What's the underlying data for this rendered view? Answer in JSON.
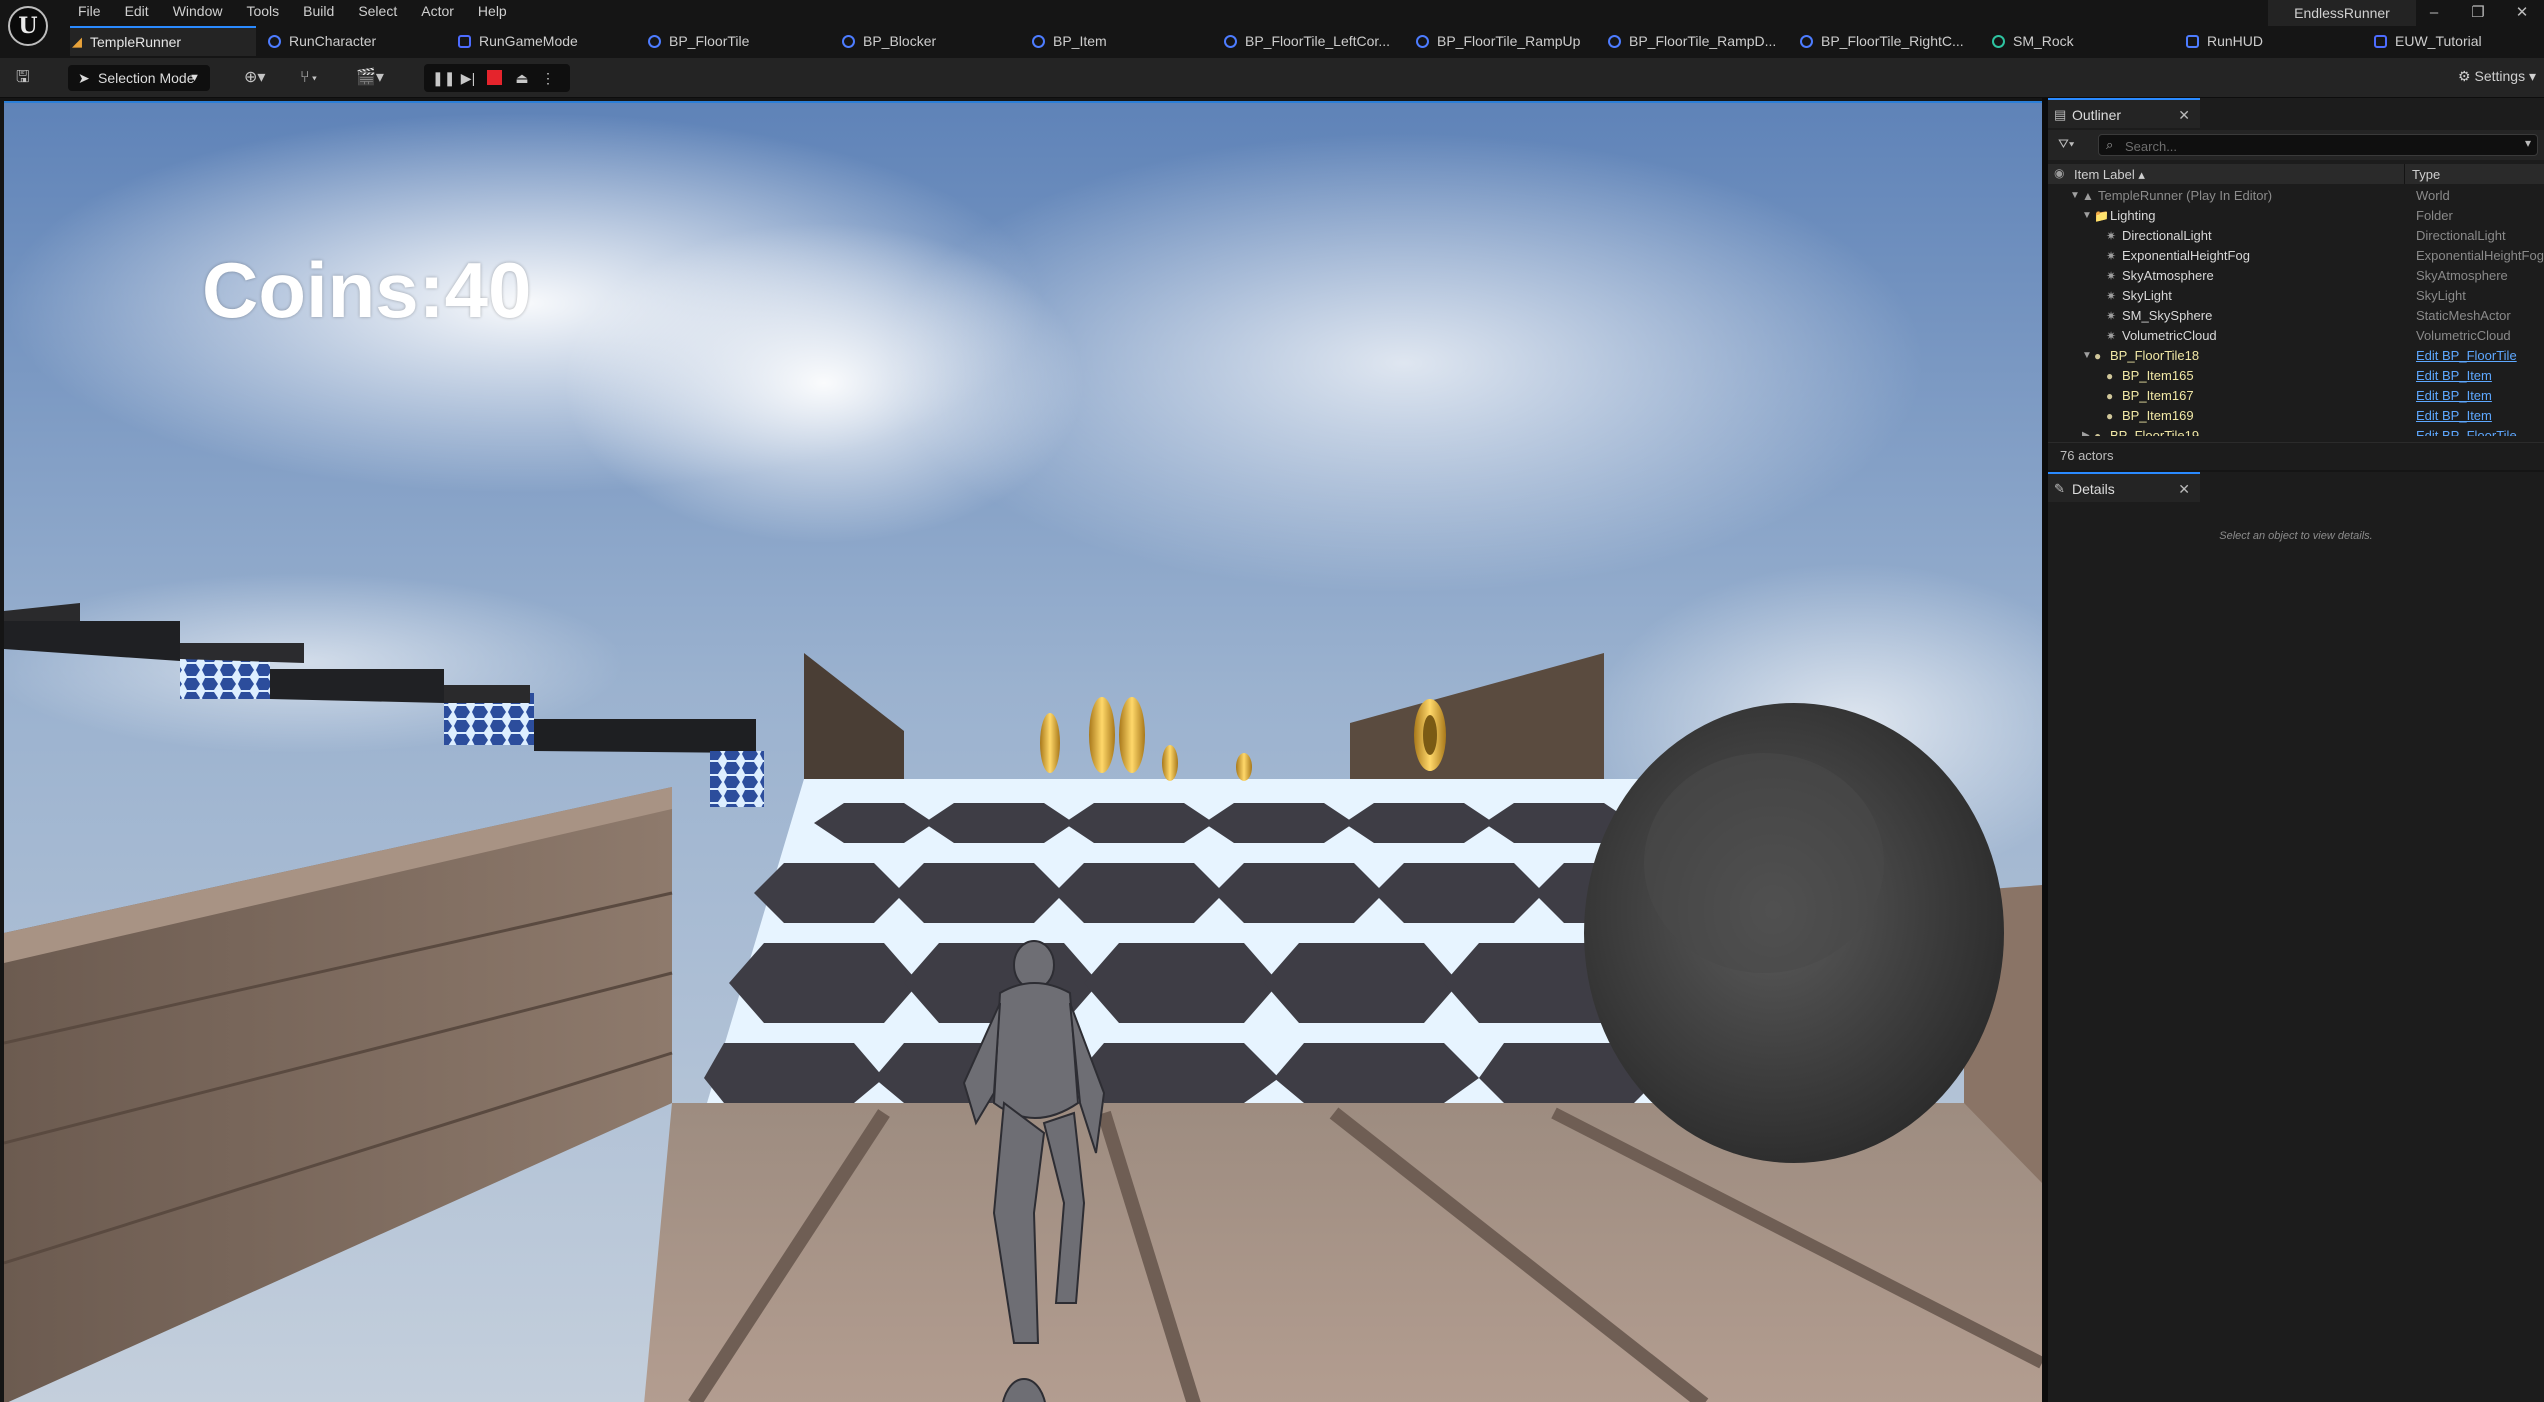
{
  "menu": [
    "File",
    "Edit",
    "Window",
    "Tools",
    "Build",
    "Select",
    "Actor",
    "Help"
  ],
  "project_name": "EndlessRunner",
  "tabs": [
    {
      "label": "TempleRunner",
      "icon": "level-icon",
      "active": true
    },
    {
      "label": "RunCharacter",
      "icon": "blueprint-icon"
    },
    {
      "label": "RunGameMode",
      "icon": "widget-icon"
    },
    {
      "label": "BP_FloorTile",
      "icon": "blueprint-icon"
    },
    {
      "label": "BP_Blocker",
      "icon": "blueprint-icon"
    },
    {
      "label": "BP_Item",
      "icon": "blueprint-icon"
    },
    {
      "label": "BP_FloorTile_LeftCor...",
      "icon": "blueprint-icon"
    },
    {
      "label": "BP_FloorTile_RampUp",
      "icon": "blueprint-icon"
    },
    {
      "label": "BP_FloorTile_RampD...",
      "icon": "blueprint-icon"
    },
    {
      "label": "BP_FloorTile_RightC...",
      "icon": "blueprint-icon"
    },
    {
      "label": "SM_Rock",
      "icon": "static-mesh-icon"
    },
    {
      "label": "RunHUD",
      "icon": "hud-icon"
    },
    {
      "label": "EUW_Tutorial",
      "icon": "widget-icon"
    }
  ],
  "toolbar": {
    "selection_mode": "Selection Mode",
    "settings_label": "Settings"
  },
  "viewport": {
    "hud_coins": "Coins:40"
  },
  "outliner": {
    "tab_label": "Outliner",
    "search_placeholder": "Search...",
    "col_label": "Item Label",
    "col_type": "Type",
    "rows": [
      {
        "label": "TempleRunner (Play In Editor)",
        "type": "World",
        "indent": 0,
        "expand": "down",
        "dim": true
      },
      {
        "label": "Lighting",
        "type": "Folder",
        "indent": 1,
        "expand": "down",
        "icon": "folder"
      },
      {
        "label": "DirectionalLight",
        "type": "DirectionalLight",
        "indent": 2
      },
      {
        "label": "ExponentialHeightFog",
        "type": "ExponentialHeightFog",
        "indent": 2
      },
      {
        "label": "SkyAtmosphere",
        "type": "SkyAtmosphere",
        "indent": 2
      },
      {
        "label": "SkyLight",
        "type": "SkyLight",
        "indent": 2
      },
      {
        "label": "SM_SkySphere",
        "type": "StaticMeshActor",
        "indent": 2
      },
      {
        "label": "VolumetricCloud",
        "type": "VolumetricCloud",
        "indent": 2
      },
      {
        "label": "BP_FloorTile18",
        "type": "Edit BP_FloorTile",
        "indent": 1,
        "expand": "down",
        "link": true,
        "yellow": true
      },
      {
        "label": "BP_Item165",
        "type": "Edit BP_Item",
        "indent": 2,
        "link": true,
        "yellow": true
      },
      {
        "label": "BP_Item167",
        "type": "Edit BP_Item",
        "indent": 2,
        "link": true,
        "yellow": true
      },
      {
        "label": "BP_Item169",
        "type": "Edit BP_Item",
        "indent": 2,
        "link": true,
        "yellow": true
      },
      {
        "label": "BP_FloorTile19",
        "type": "Edit BP_FloorTile",
        "indent": 1,
        "expand": "right",
        "link": true,
        "yellow": true
      }
    ],
    "actor_count": "76 actors"
  },
  "details": {
    "tab_label": "Details",
    "empty_message": "Select an object to view details."
  },
  "colors": {
    "accent": "#2a8aff",
    "stop": "#e5242c",
    "link": "#5ea8ff",
    "tile_glow": "#bfe0ff"
  }
}
